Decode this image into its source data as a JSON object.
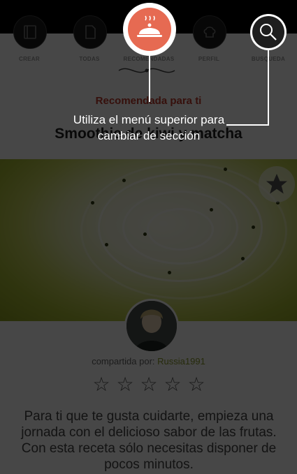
{
  "nav": {
    "items": [
      {
        "label": "CREAR",
        "icon": "book-icon"
      },
      {
        "label": "TODAS",
        "icon": "page-icon"
      },
      {
        "label": "RECOMENDADAS",
        "icon": "serving-dish-icon"
      },
      {
        "label": "PERFIL",
        "icon": "chef-hat-icon"
      },
      {
        "label": "BUSQUEDA",
        "icon": "search-icon"
      }
    ]
  },
  "recipe": {
    "section_title": "Recomendada para ti",
    "title": "Smoothie de kiwi y matcha",
    "shared_prefix": "compartida por:",
    "author": "Russia1991",
    "rating": 0,
    "rating_max": 5,
    "description": "Para ti que te gusta cuidarte, empieza una jornada con el delicioso sabor de las frutas. Con esta receta sólo necesitas disponer de pocos minutos."
  },
  "tutorial": {
    "tip": "Utiliza el menú superior para cambiar de sección"
  },
  "colors": {
    "accent": "#e66a52",
    "title_red": "#c0392b",
    "username_green": "#8a9a2a"
  }
}
